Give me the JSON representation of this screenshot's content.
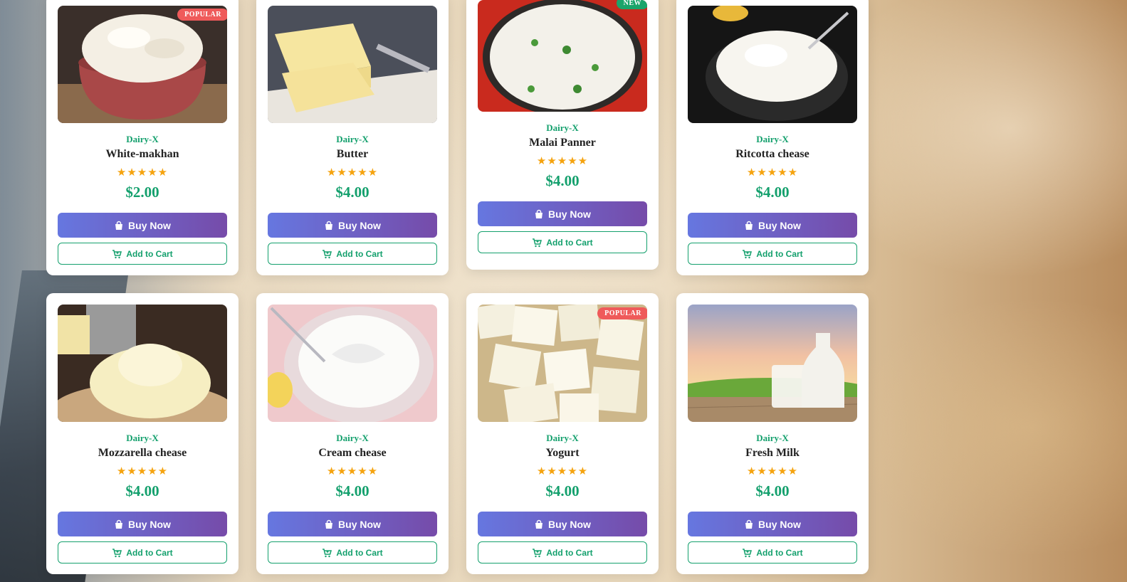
{
  "buy_label": "Buy Now",
  "cart_label": "Add to Cart",
  "rating_stars": "★★★★★",
  "colors": {
    "accent_green": "#14a06d",
    "buy_gradient_start": "#6677e0",
    "buy_gradient_end": "#764ba9",
    "badge_popular": "#ef5a5a",
    "badge_new": "#1aa46a",
    "star": "#f5a30f"
  },
  "products": [
    {
      "brand": "Dairy-X",
      "name": "White-makhan",
      "price": "$2.00",
      "badge": "POPULAR",
      "rating": 5
    },
    {
      "brand": "Dairy-X",
      "name": "Butter",
      "price": "$4.00",
      "badge": "",
      "rating": 5
    },
    {
      "brand": "Dairy-X",
      "name": "Malai Panner",
      "price": "$4.00",
      "badge": "NEW",
      "rating": 5
    },
    {
      "brand": "Dairy-X",
      "name": "Ritcotta chease",
      "price": "$4.00",
      "badge": "",
      "rating": 5
    },
    {
      "brand": "Dairy-X",
      "name": "Mozzarella chease",
      "price": "$4.00",
      "badge": "",
      "rating": 5
    },
    {
      "brand": "Dairy-X",
      "name": "Cream chease",
      "price": "$4.00",
      "badge": "",
      "rating": 5
    },
    {
      "brand": "Dairy-X",
      "name": "Yogurt",
      "price": "$4.00",
      "badge": "POPULAR",
      "rating": 5
    },
    {
      "brand": "Dairy-X",
      "name": "Fresh Milk",
      "price": "$4.00",
      "badge": "",
      "rating": 5
    }
  ]
}
